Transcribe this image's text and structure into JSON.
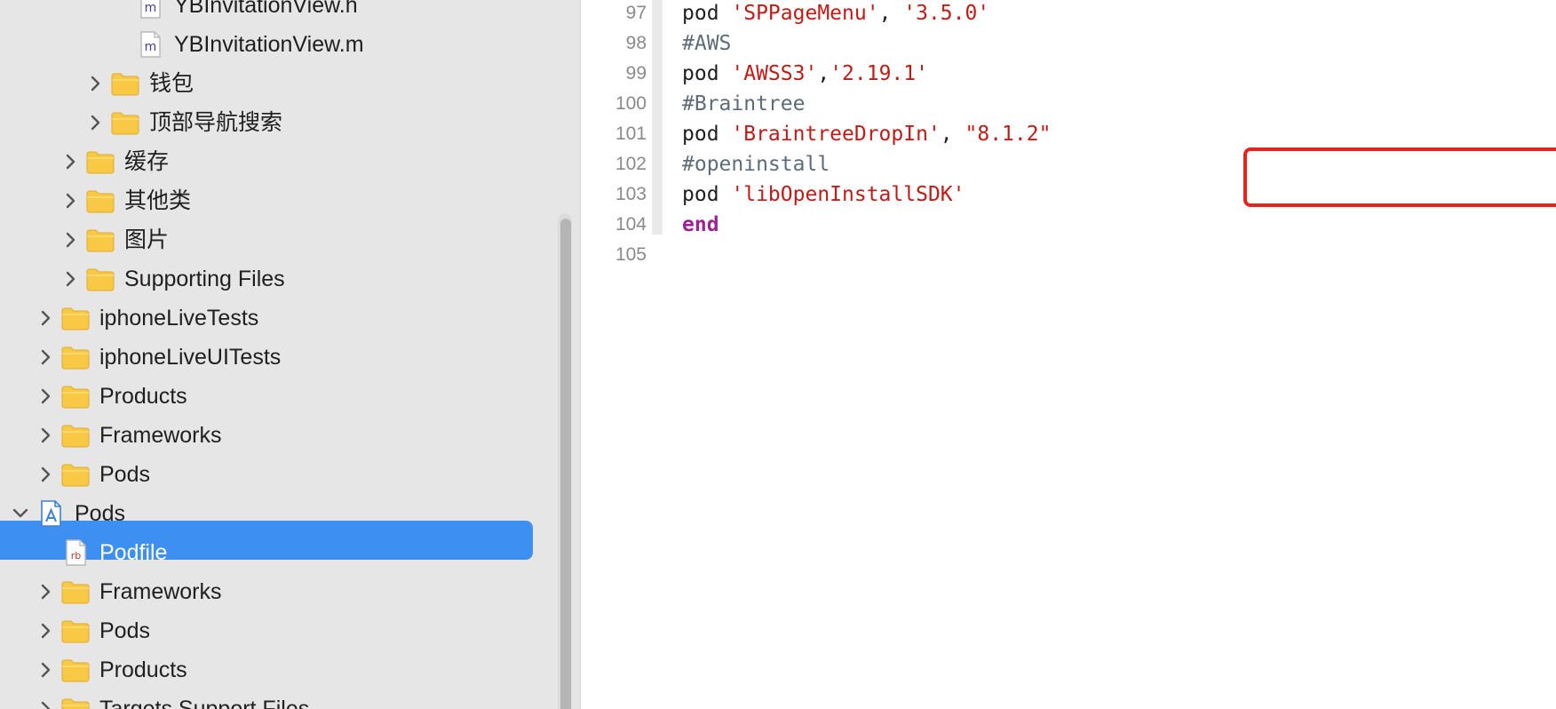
{
  "navigator": {
    "items": [
      {
        "label": "YBInvitationView.h",
        "type": "file-h",
        "expanded": null,
        "selected": false
      },
      {
        "label": "YBInvitationView.m",
        "type": "file-m",
        "expanded": null,
        "selected": false
      },
      {
        "label": "钱包",
        "type": "folder",
        "expanded": false,
        "selected": false
      },
      {
        "label": "顶部导航搜索",
        "type": "folder",
        "expanded": false,
        "selected": false
      },
      {
        "label": "缓存",
        "type": "folder",
        "expanded": false,
        "selected": false
      },
      {
        "label": "其他类",
        "type": "folder",
        "expanded": false,
        "selected": false
      },
      {
        "label": "图片",
        "type": "folder",
        "expanded": false,
        "selected": false
      },
      {
        "label": "Supporting Files",
        "type": "folder",
        "expanded": false,
        "selected": false
      },
      {
        "label": "iphoneLiveTests",
        "type": "folder",
        "expanded": false,
        "selected": false
      },
      {
        "label": "iphoneLiveUITests",
        "type": "folder",
        "expanded": false,
        "selected": false
      },
      {
        "label": "Products",
        "type": "folder",
        "expanded": false,
        "selected": false
      },
      {
        "label": "Frameworks",
        "type": "folder",
        "expanded": false,
        "selected": false
      },
      {
        "label": "Pods",
        "type": "folder",
        "expanded": false,
        "selected": false
      },
      {
        "label": "Pods",
        "type": "project",
        "expanded": true,
        "selected": false
      },
      {
        "label": "Podfile",
        "type": "file-rb",
        "expanded": null,
        "selected": true
      },
      {
        "label": "Frameworks",
        "type": "folder",
        "expanded": false,
        "selected": false
      },
      {
        "label": "Pods",
        "type": "folder",
        "expanded": false,
        "selected": false
      },
      {
        "label": "Products",
        "type": "folder",
        "expanded": false,
        "selected": false
      },
      {
        "label": "Targets Support Files",
        "type": "folder",
        "expanded": false,
        "selected": false
      }
    ],
    "file_badges": {
      "m": "m",
      "rb": "rb"
    }
  },
  "editor": {
    "lines": [
      {
        "num": "97",
        "tokens": [
          {
            "t": "pod ",
            "k": "plain"
          },
          {
            "t": "'SPPageMenu'",
            "k": "str"
          },
          {
            "t": ", ",
            "k": "plain"
          },
          {
            "t": "'3.5.0'",
            "k": "str"
          }
        ]
      },
      {
        "num": "98",
        "tokens": [
          {
            "t": "#AWS",
            "k": "comment"
          }
        ]
      },
      {
        "num": "99",
        "tokens": [
          {
            "t": "pod ",
            "k": "plain"
          },
          {
            "t": "'AWSS3'",
            "k": "str"
          },
          {
            "t": ",",
            "k": "plain"
          },
          {
            "t": "'2.19.1'",
            "k": "str"
          }
        ]
      },
      {
        "num": "100",
        "tokens": [
          {
            "t": "#Braintree",
            "k": "comment"
          }
        ]
      },
      {
        "num": "101",
        "tokens": [
          {
            "t": "pod ",
            "k": "plain"
          },
          {
            "t": "'BraintreeDropIn'",
            "k": "str"
          },
          {
            "t": ", ",
            "k": "plain"
          },
          {
            "t": "\"8.1.2\"",
            "k": "str"
          }
        ]
      },
      {
        "num": "102",
        "tokens": [
          {
            "t": "#openinstall",
            "k": "comment"
          }
        ]
      },
      {
        "num": "103",
        "tokens": [
          {
            "t": "pod ",
            "k": "plain"
          },
          {
            "t": "'libOpenInstallSDK'",
            "k": "str"
          }
        ]
      },
      {
        "num": "104",
        "tokens": [
          {
            "t": "end",
            "k": "keyword"
          }
        ]
      },
      {
        "num": "105",
        "tokens": []
      }
    ]
  },
  "colors": {
    "sidebar_bg": "#e6e6e6",
    "selection": "#3d8ff2",
    "folder": "#f9c845",
    "string": "#c41a16",
    "comment": "#5d6c79",
    "keyword": "#9b2393",
    "annotation": "#e3251d"
  }
}
